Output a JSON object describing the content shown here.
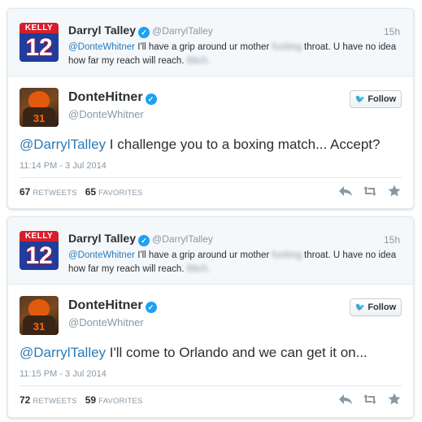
{
  "cards": [
    {
      "parent": {
        "avatar": {
          "name_text": "KELLY",
          "number_text": "12"
        },
        "name": "Darryl Talley",
        "handle": "@DarrylTalley",
        "time": "15h",
        "mention": "@DonteWhitner",
        "text_before": "I'll have a grip around ur mother",
        "text_blurred": "fucking",
        "text_after": "throat. U have no idea how far my reach will reach.",
        "text_blurred_end": "Bitch."
      },
      "main": {
        "avatar": {
          "number_text": "31"
        },
        "name": "DonteHitner",
        "handle": "@DonteWhitner",
        "follow_label": "Follow",
        "mention": "@DarrylTalley",
        "text": "I challenge you to a boxing match... Accept?",
        "date": "11:14 PM - 3 Jul 2014",
        "retweets": "67",
        "retweets_label": "RETWEETS",
        "favorites": "65",
        "favorites_label": "FAVORITES"
      }
    },
    {
      "parent": {
        "avatar": {
          "name_text": "KELLY",
          "number_text": "12"
        },
        "name": "Darryl Talley",
        "handle": "@DarrylTalley",
        "time": "15h",
        "mention": "@DonteWhitner",
        "text_before": "I'll have a grip around ur mother",
        "text_blurred": "fucking",
        "text_after": "throat. U have no idea how far my reach will reach.",
        "text_blurred_end": "Bitch."
      },
      "main": {
        "avatar": {
          "number_text": "31"
        },
        "name": "DonteHitner",
        "handle": "@DonteWhitner",
        "follow_label": "Follow",
        "mention": "@DarrylTalley",
        "text": "I'll come to Orlando and we can get it on...",
        "date": "11:15 PM - 3 Jul 2014",
        "retweets": "72",
        "retweets_label": "RETWEETS",
        "favorites": "59",
        "favorites_label": "FAVORITES"
      }
    }
  ],
  "colors": {
    "link": "#2b7bb9",
    "verified": "#1da1f2",
    "muted": "#8899a6"
  },
  "icons": {
    "verified": "verified-badge-icon",
    "reply": "reply-icon",
    "retweet": "retweet-icon",
    "favorite": "star-icon",
    "bird": "twitter-bird-icon"
  }
}
